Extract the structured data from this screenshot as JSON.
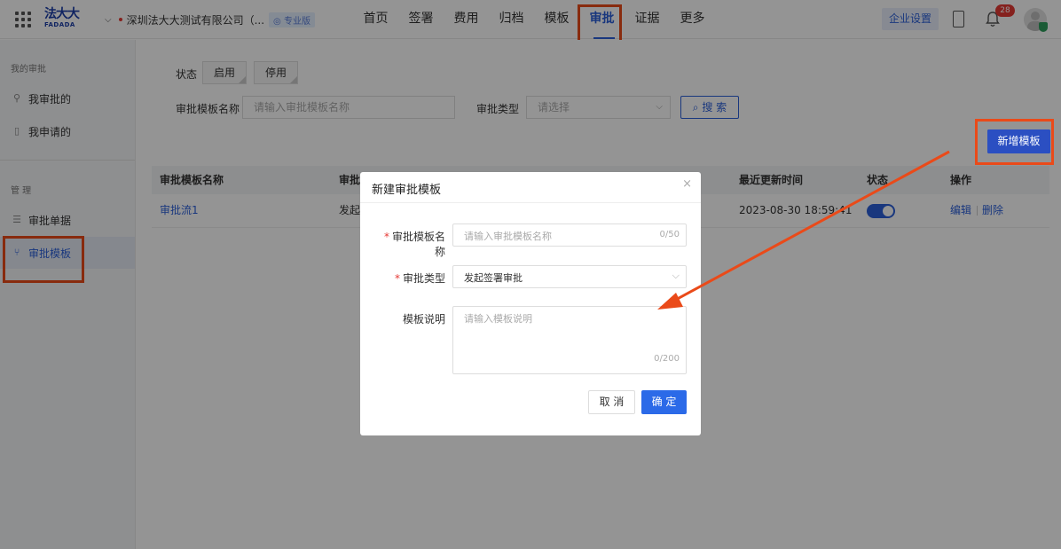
{
  "topbar": {
    "logo_main": "法大大",
    "logo_sub": "FADADA",
    "company_name": "深圳法大大测试有限公司（...",
    "company_badge": "◎ 专业版",
    "nav": [
      "首页",
      "签署",
      "费用",
      "归档",
      "模板",
      "审批",
      "证据",
      "更多"
    ],
    "active_nav": "审批",
    "settings_label": "企业设置",
    "notification_count": "28"
  },
  "sidebar": {
    "group1": "我的审批",
    "my_approve": "我审批的",
    "my_apply": "我申请的",
    "group2": "管 理",
    "approval_forms": "审批单据",
    "approval_templates": "审批模板"
  },
  "filters": {
    "status_label": "状态",
    "enabled": "启用",
    "disabled": "停用",
    "name_label": "审批模板名称",
    "name_placeholder": "请输入审批模板名称",
    "type_label": "审批类型",
    "type_placeholder": "请选择",
    "search_label": "搜 索",
    "new_template": "新增模板"
  },
  "table": {
    "headers": {
      "name": "审批模板名称",
      "type": "审批",
      "updated": "最近更新时间",
      "status": "状态",
      "actions": "操作"
    },
    "rows": [
      {
        "name": "审批流1",
        "type": "发起",
        "updated": "2023-08-30 18:59:41",
        "status_on": true,
        "edit": "编辑",
        "delete": "删除"
      }
    ]
  },
  "modal": {
    "title": "新建审批模板",
    "close": "×",
    "name_label": "审批模板名称",
    "name_placeholder": "请输入审批模板名称",
    "name_count": "0/50",
    "type_label": "审批类型",
    "type_value": "发起签署审批",
    "desc_label": "模板说明",
    "desc_placeholder": "请输入模板说明",
    "desc_count": "0/200",
    "cancel": "取 消",
    "ok": "确 定"
  },
  "colors": {
    "primary": "#2b5fd9",
    "highlight": "#ea4a19",
    "danger": "#e53935"
  }
}
